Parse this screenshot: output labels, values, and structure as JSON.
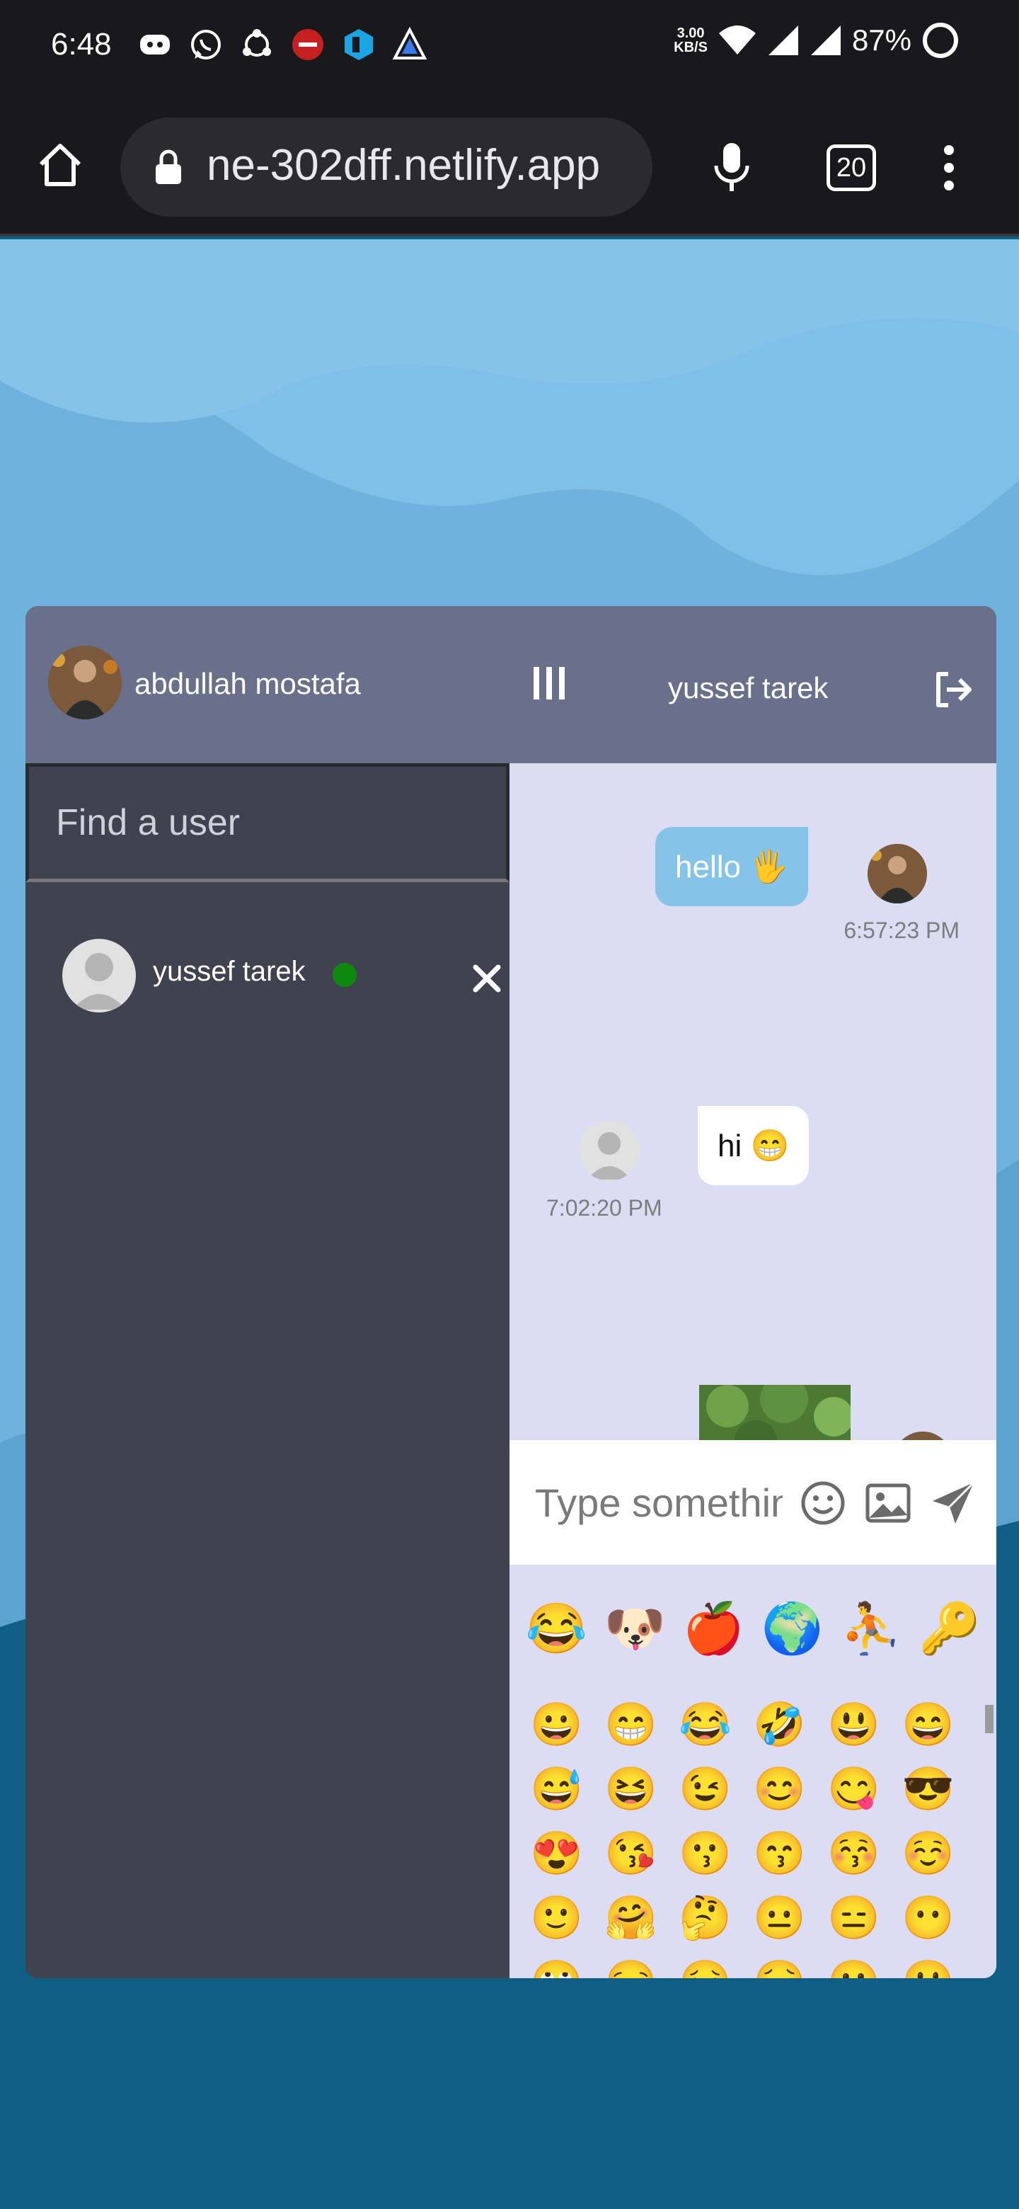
{
  "status_bar": {
    "time": "6:48",
    "net_speed_top": "3.00",
    "net_speed_bottom": "KB/S",
    "battery": "87%"
  },
  "browser": {
    "url": "ne-302dff.netlify.app",
    "tab_count": "20"
  },
  "header": {
    "current_user": "abdullah mostafa",
    "chat_partner": "yussef tarek"
  },
  "sidebar": {
    "search_placeholder": "Find a user",
    "users": [
      {
        "name": "yussef tarek",
        "online": true
      }
    ]
  },
  "messages": [
    {
      "text": "hello 🖐",
      "time": "6:57:23 PM",
      "own": true
    },
    {
      "text": "hi 😁",
      "time": "7:02:20 PM",
      "own": false
    }
  ],
  "composer": {
    "placeholder": "Type something..."
  },
  "emoji_panel": {
    "categories": [
      "😂",
      "🐶",
      "🍎",
      "🌍",
      "⛹",
      "🔑"
    ],
    "grid": [
      "😀",
      "😁",
      "😂",
      "🤣",
      "😃",
      "😄",
      "😅",
      "😆",
      "😉",
      "😊",
      "😋",
      "😎",
      "😍",
      "😘",
      "😗",
      "😙",
      "😚",
      "☺️",
      "🙂",
      "🤗",
      "🤔",
      "😐",
      "😑",
      "😶",
      "🙄",
      "😏",
      "😣",
      "😥",
      "😮",
      "🤐"
    ]
  },
  "colors": {
    "header": "#6a7089",
    "sidebar": "#41414f",
    "chat_bg": "#dddcf5",
    "own_bubble": "#86c3e8",
    "online": "#0d8a0d"
  }
}
